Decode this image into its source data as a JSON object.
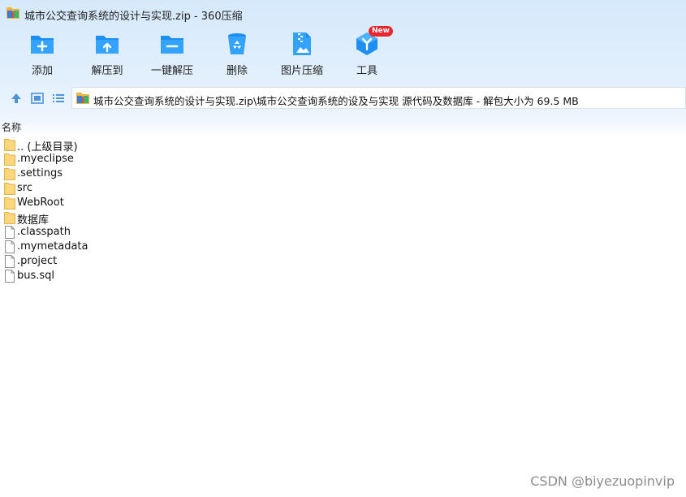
{
  "window": {
    "title": "城市公交查询系统的设计与实现.zip - 360压缩"
  },
  "toolbar": {
    "items": [
      {
        "label": "添加",
        "icon": "add-folder-icon"
      },
      {
        "label": "解压到",
        "icon": "extract-to-icon"
      },
      {
        "label": "一键解压",
        "icon": "one-click-extract-icon"
      },
      {
        "label": "删除",
        "icon": "recycle-bin-icon"
      },
      {
        "label": "图片压缩",
        "icon": "image-compress-icon"
      },
      {
        "label": "工具",
        "icon": "tools-icon",
        "badge": "New"
      }
    ]
  },
  "nav": {
    "path": "城市公交查询系统的设计与实现.zip\\城市公交查询系统的设及与实现  源代码及数据库 - 解包大小为 69.5 MB"
  },
  "list": {
    "header": "名称",
    "items": [
      {
        "name": ".. (上级目录)",
        "type": "folder"
      },
      {
        "name": ".myeclipse",
        "type": "folder"
      },
      {
        "name": ".settings",
        "type": "folder"
      },
      {
        "name": "src",
        "type": "folder"
      },
      {
        "name": "WebRoot",
        "type": "folder"
      },
      {
        "name": "数据库",
        "type": "folder"
      },
      {
        "name": ".classpath",
        "type": "file"
      },
      {
        "name": ".mymetadata",
        "type": "file"
      },
      {
        "name": ".project",
        "type": "file"
      },
      {
        "name": "bus.sql",
        "type": "file"
      }
    ]
  },
  "watermark": "CSDN @biyezuopinvip",
  "colors": {
    "accent": "#2196f3",
    "accent_dark": "#1976d2",
    "folder": "#fbd67a",
    "badge": "#e8262c"
  }
}
